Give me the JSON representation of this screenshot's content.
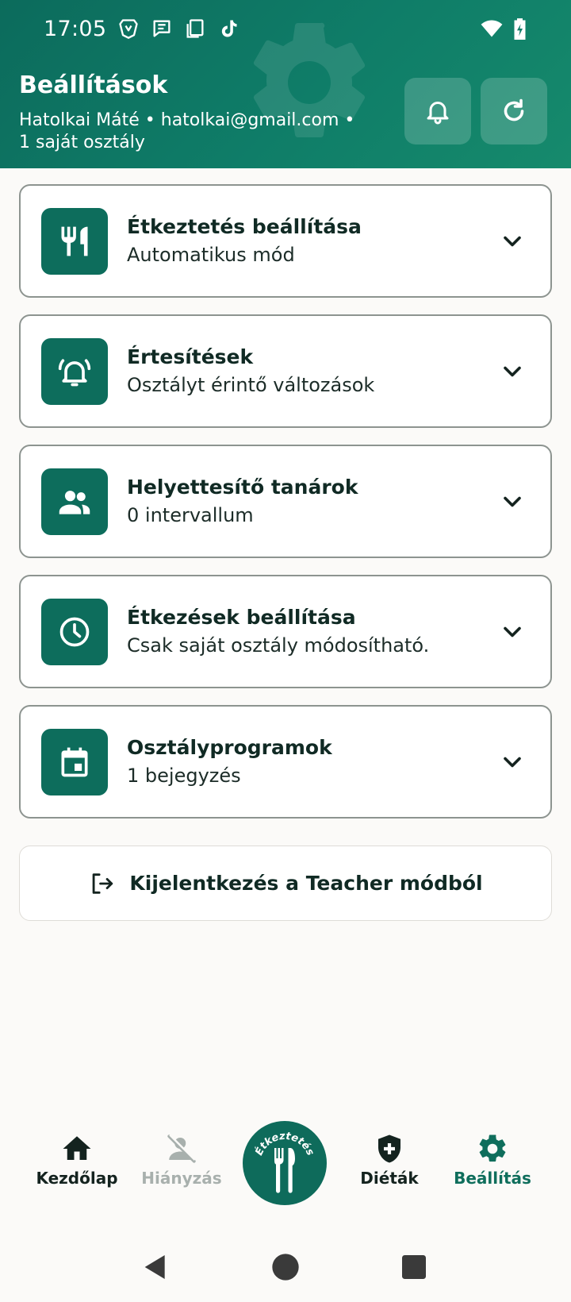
{
  "status_bar": {
    "time": "17:05"
  },
  "header": {
    "title": "Beállítások",
    "subtitle": "Hatolkai Máté • hatolkai@gmail.com • 1 saját osztály"
  },
  "cards": [
    {
      "title": "Étkeztetés beállítása",
      "subtitle": "Automatikus mód",
      "icon": "fork-knife-icon"
    },
    {
      "title": "Értesítések",
      "subtitle": "Osztályt érintő változások",
      "icon": "bell-ringing-icon"
    },
    {
      "title": "Helyettesítő tanárok",
      "subtitle": "0 intervallum",
      "icon": "people-icon"
    },
    {
      "title": "Étkezések beállítása",
      "subtitle": "Csak saját osztály módosítható.",
      "icon": "clock-icon"
    },
    {
      "title": "Osztályprogramok",
      "subtitle": "1 bejegyzés",
      "icon": "calendar-icon"
    }
  ],
  "logout": {
    "label": "Kijelentkezés a Teacher módból"
  },
  "bottom_nav": {
    "home": "Kezdőlap",
    "absence": "Hiányzás",
    "center": "Étkeztetés",
    "diets": "Diéták",
    "settings": "Beállítás"
  },
  "colors": {
    "primary": "#0d6d5c",
    "header_gradient_start": "#0c6b5c",
    "header_gradient_end": "#168a6c",
    "disabled_text": "#a8b0ad"
  }
}
